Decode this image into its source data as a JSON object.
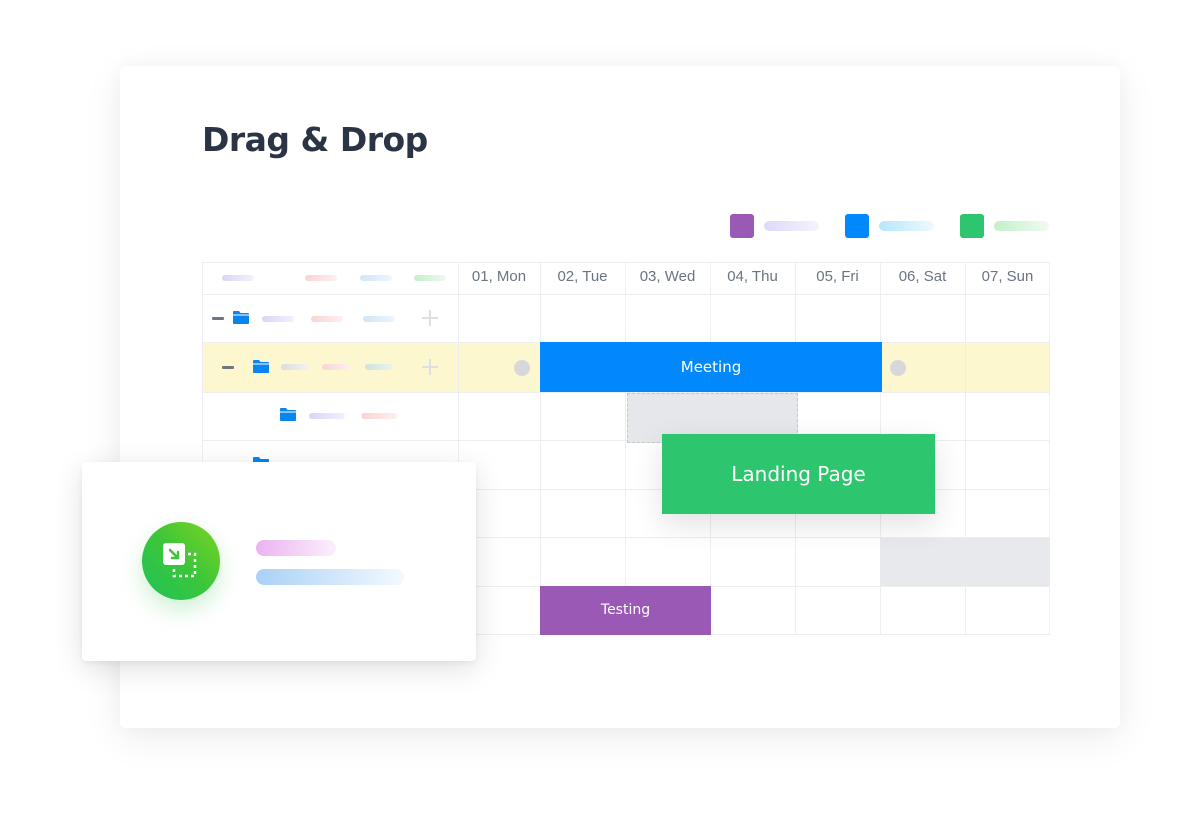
{
  "page": {
    "title": "Drag & Drop"
  },
  "legend": [
    {
      "color": "#9b59b6",
      "name": "purple-category"
    },
    {
      "color": "#0288fd",
      "name": "blue-category"
    },
    {
      "color": "#2ec56f",
      "name": "green-category"
    }
  ],
  "calendar": {
    "days": [
      "01, Mon",
      "02, Tue",
      "03, Wed",
      "04, Thu",
      "05, Fri",
      "06, Sat",
      "07, Sun"
    ],
    "events": {
      "meeting": {
        "label": "Meeting",
        "start_day": "02, Tue",
        "end_day": "05, Fri",
        "color": "#0288fd"
      },
      "landing_page": {
        "label": "Landing Page",
        "state": "dragging",
        "color": "#2ec56f"
      },
      "testing": {
        "label": "Testing",
        "start_day": "02, Tue",
        "end_day": "03, Wed",
        "color": "#9b59b6"
      }
    },
    "highlight_color": "#fdf7cf"
  },
  "popup": {
    "icon": "drag-drop-icon",
    "accent_gradient": [
      "#7ed321",
      "#1ec25a"
    ]
  }
}
